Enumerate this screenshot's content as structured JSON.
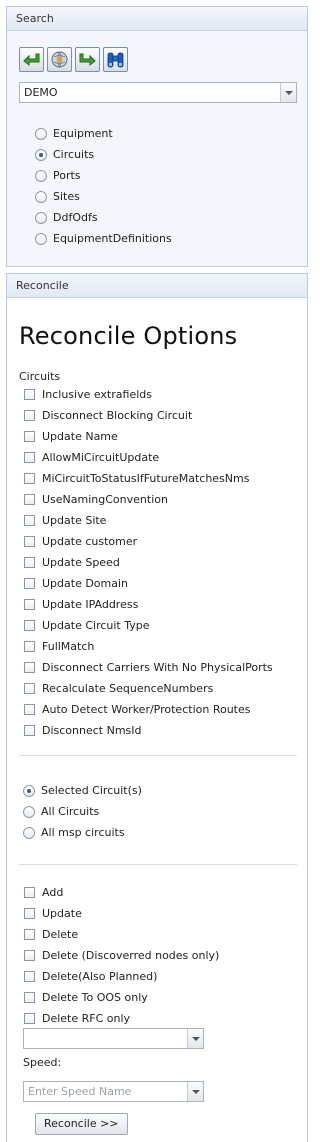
{
  "search": {
    "header": "Search",
    "toolbar": [
      {
        "name": "back-icon"
      },
      {
        "name": "globe-icon"
      },
      {
        "name": "forward-icon"
      },
      {
        "name": "binoculars-icon"
      }
    ],
    "database_value": "DEMO",
    "types": [
      {
        "label": "Equipment",
        "selected": false
      },
      {
        "label": "Circuits",
        "selected": true
      },
      {
        "label": "Ports",
        "selected": false
      },
      {
        "label": "Sites",
        "selected": false
      },
      {
        "label": "DdfOdfs",
        "selected": false
      },
      {
        "label": "EquipmentDefinitions",
        "selected": false
      }
    ]
  },
  "reconcile": {
    "header": "Reconcile",
    "title": "Reconcile Options",
    "circuits_label": "Circuits",
    "options": [
      {
        "label": "Inclusive extrafields",
        "checked": false
      },
      {
        "label": "Disconnect Blocking Circuit",
        "checked": false
      },
      {
        "label": "Update Name",
        "checked": false
      },
      {
        "label": "AllowMiCircuitUpdate",
        "checked": false
      },
      {
        "label": "MiCircuitToStatusIfFutureMatchesNms",
        "checked": false
      },
      {
        "label": "UseNamingConvention",
        "checked": false
      },
      {
        "label": "Update Site",
        "checked": false
      },
      {
        "label": "Update customer",
        "checked": false
      },
      {
        "label": "Update Speed",
        "checked": false
      },
      {
        "label": "Update Domain",
        "checked": false
      },
      {
        "label": "Update IPAddress",
        "checked": false
      },
      {
        "label": "Update Circuit Type",
        "checked": false
      },
      {
        "label": "FullMatch",
        "checked": false
      },
      {
        "label": "Disconnect Carriers With No PhysicalPorts",
        "checked": false
      },
      {
        "label": "Recalculate SequenceNumbers",
        "checked": false
      },
      {
        "label": "Auto Detect Worker/Protection Routes",
        "checked": false
      },
      {
        "label": "Disconnect NmsId",
        "checked": false
      }
    ],
    "scope": [
      {
        "label": "Selected Circuit(s)",
        "selected": true
      },
      {
        "label": "All Circuits",
        "selected": false
      },
      {
        "label": "All msp circuits",
        "selected": false
      }
    ],
    "actions": [
      {
        "label": "Add",
        "checked": false
      },
      {
        "label": "Update",
        "checked": false
      },
      {
        "label": "Delete",
        "checked": false
      },
      {
        "label": "Delete (Discoverred nodes only)",
        "checked": false
      },
      {
        "label": "Delete(Also Planned)",
        "checked": false
      },
      {
        "label": "Delete To OOS only",
        "checked": false
      },
      {
        "label": "Delete RFC only",
        "checked": false
      }
    ],
    "status_value": "",
    "speed_label": "Speed:",
    "speed_placeholder": "Enter Speed Name",
    "button_label": "Reconcile >>"
  }
}
